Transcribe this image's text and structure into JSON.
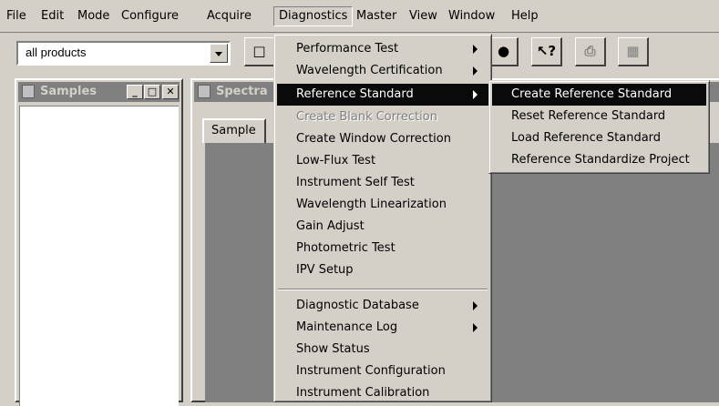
{
  "menubar": {
    "items": [
      "File",
      "Edit",
      "Mode",
      "Configure",
      "Acquire",
      "Diagnostics",
      "Master",
      "View",
      "Window",
      "Help"
    ]
  },
  "toolbar": {
    "product_filter": {
      "value": "all products"
    }
  },
  "samples_panel": {
    "title": "Samples"
  },
  "spectra_panel": {
    "title": "Spectra",
    "tab_label": "Sample"
  },
  "diagnostics_menu": {
    "items": [
      {
        "label": "Performance Test",
        "submenu": true
      },
      {
        "label": "Wavelength Certification",
        "submenu": true
      },
      {
        "label": "Reference Standard",
        "submenu": true,
        "highlighted": true
      },
      {
        "label": "Create Blank Correction",
        "disabled": true
      },
      {
        "label": "Create Window Correction"
      },
      {
        "label": "Low-Flux Test"
      },
      {
        "label": "Instrument Self Test"
      },
      {
        "label": "Wavelength Linearization"
      },
      {
        "label": "Gain Adjust"
      },
      {
        "label": "Photometric Test"
      },
      {
        "label": "IPV Setup"
      },
      {
        "label": "Diagnostic Database",
        "submenu": true
      },
      {
        "label": "Maintenance Log",
        "submenu": true
      },
      {
        "label": "Show Status"
      },
      {
        "label": "Instrument Configuration"
      },
      {
        "label": "Instrument Calibration"
      }
    ]
  },
  "reference_standard_submenu": {
    "items": [
      {
        "label": "Create Reference Standard",
        "highlighted": true
      },
      {
        "label": "Reset Reference Standard"
      },
      {
        "label": "Load Reference Standard"
      },
      {
        "label": "Reference Standardize Project"
      }
    ]
  }
}
